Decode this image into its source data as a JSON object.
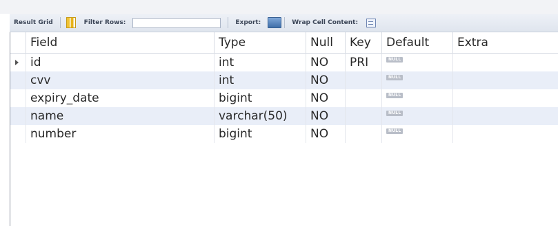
{
  "toolbar": {
    "result_grid_label": "Result Grid",
    "filter_rows_label": "Filter Rows:",
    "filter_value": "",
    "export_label": "Export:",
    "wrap_cell_label": "Wrap Cell Content:"
  },
  "grid": {
    "columns": [
      "Field",
      "Type",
      "Null",
      "Key",
      "Default",
      "Extra"
    ],
    "rows": [
      {
        "field": "id",
        "type": "int",
        "null": "NO",
        "key": "PRI",
        "default": "NULL",
        "extra": ""
      },
      {
        "field": "cvv",
        "type": "int",
        "null": "NO",
        "key": "",
        "default": "NULL",
        "extra": ""
      },
      {
        "field": "expiry_date",
        "type": "bigint",
        "null": "NO",
        "key": "",
        "default": "NULL",
        "extra": ""
      },
      {
        "field": "name",
        "type": "varchar(50)",
        "null": "NO",
        "key": "",
        "default": "NULL",
        "extra": ""
      },
      {
        "field": "number",
        "type": "bigint",
        "null": "NO",
        "key": "",
        "default": "NULL",
        "extra": ""
      }
    ]
  }
}
